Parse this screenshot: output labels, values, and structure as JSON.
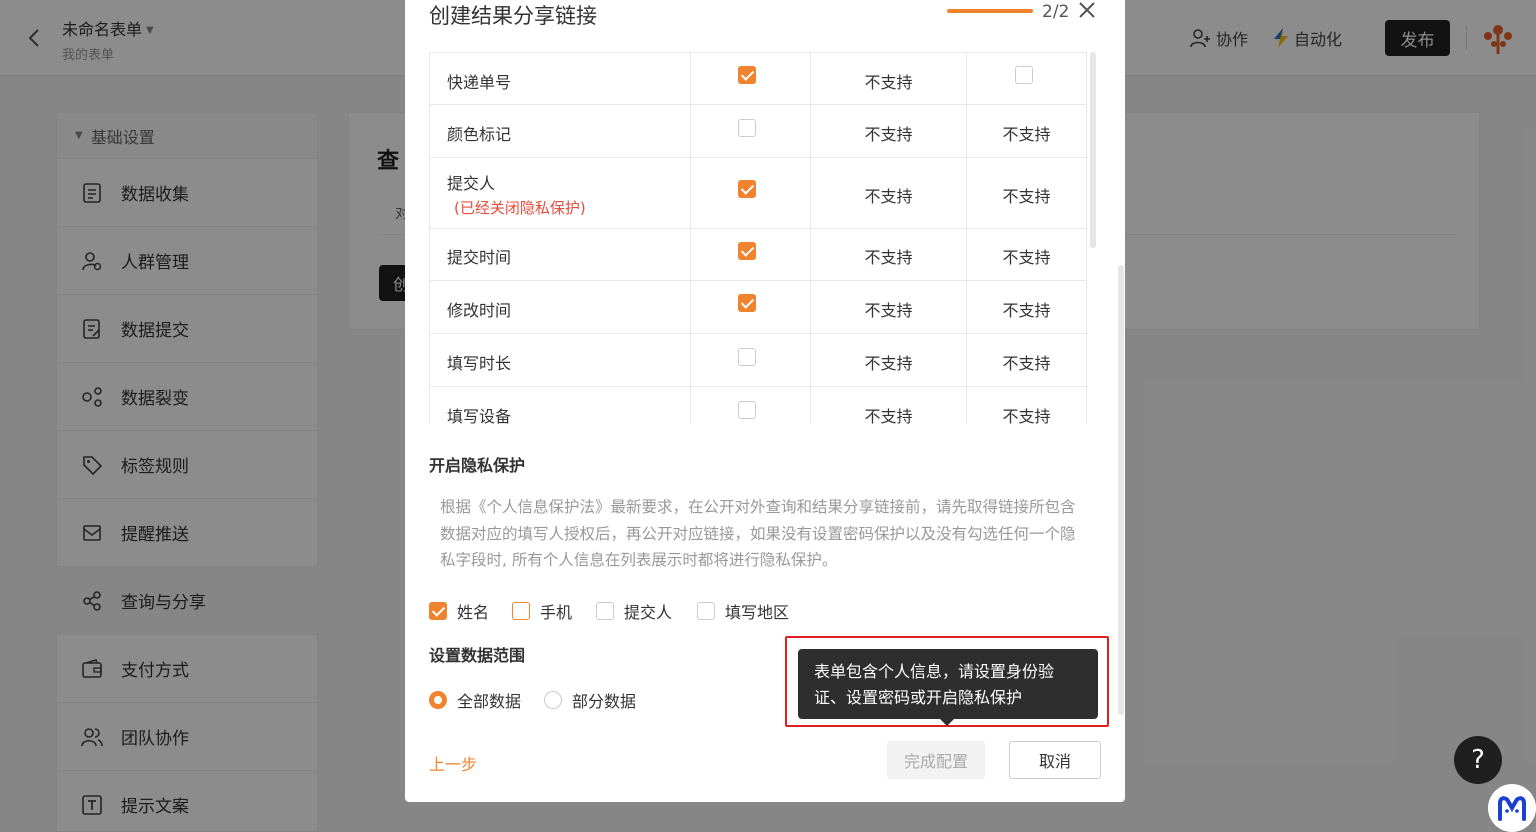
{
  "header": {
    "form_title": "未命名表单",
    "form_subtitle": "我的表单",
    "collab_label": "协作",
    "automation_label": "自动化",
    "publish_label": "发布"
  },
  "sidebar": {
    "section_label": "基础设置",
    "items": [
      {
        "label": "数据收集",
        "icon": "document-icon"
      },
      {
        "label": "人群管理",
        "icon": "person-icon"
      },
      {
        "label": "数据提交",
        "icon": "edit-doc-icon"
      },
      {
        "label": "数据裂变",
        "icon": "fission-icon"
      },
      {
        "label": "标签规则",
        "icon": "tag-icon"
      },
      {
        "label": "提醒推送",
        "icon": "notify-icon"
      },
      {
        "label": "查询与分享",
        "icon": "share-icon"
      },
      {
        "label": "支付方式",
        "icon": "wallet-icon"
      },
      {
        "label": "团队协作",
        "icon": "team-icon"
      },
      {
        "label": "提示文案",
        "icon": "text-icon"
      }
    ]
  },
  "main": {
    "title_partial": "查",
    "sub_partial": "对",
    "button_partial": "创"
  },
  "modal": {
    "title": "创建结果分享链接",
    "step": "2/2",
    "progress_percent": 100,
    "accent_color": "#f0832d",
    "table_rows": [
      {
        "field": "快递单号",
        "note": "",
        "col2": true,
        "col3": "不支持",
        "col4_checkbox": false,
        "col4": ""
      },
      {
        "field": "颜色标记",
        "note": "",
        "col2": false,
        "col3": "不支持",
        "col4_checkbox": null,
        "col4": "不支持"
      },
      {
        "field": "提交人",
        "note": "(已经关闭隐私保护)",
        "col2": true,
        "col3": "不支持",
        "col4_checkbox": null,
        "col4": "不支持"
      },
      {
        "field": "提交时间",
        "note": "",
        "col2": true,
        "col3": "不支持",
        "col4_checkbox": null,
        "col4": "不支持"
      },
      {
        "field": "修改时间",
        "note": "",
        "col2": true,
        "col3": "不支持",
        "col4_checkbox": null,
        "col4": "不支持"
      },
      {
        "field": "填写时长",
        "note": "",
        "col2": false,
        "col3": "不支持",
        "col4_checkbox": null,
        "col4": "不支持"
      },
      {
        "field": "填写设备",
        "note": "",
        "col2": false,
        "col3": "不支持",
        "col4_checkbox": null,
        "col4": "不支持"
      }
    ],
    "privacy": {
      "title": "开启隐私保护",
      "description": "根据《个人信息保护法》最新要求，在公开对外查询和结果分享链接前，请先取得链接所包含数据对应的填写人授权后，再公开对应链接，如果没有设置密码保护以及没有勾选任何一个隐私字段时, 所有个人信息在列表展示时都将进行隐私保护。",
      "options": [
        {
          "label": "姓名",
          "checked": true
        },
        {
          "label": "手机",
          "checked": false
        },
        {
          "label": "提交人",
          "checked": false
        },
        {
          "label": "填写地区",
          "checked": false
        }
      ]
    },
    "range": {
      "title": "设置数据范围",
      "options": [
        {
          "label": "全部数据",
          "selected": true
        },
        {
          "label": "部分数据",
          "selected": false
        }
      ]
    },
    "tooltip": "表单包含个人信息，请设置身份验证、设置密码或开启隐私保护",
    "prev_label": "上一步",
    "finish_label": "完成配置",
    "cancel_label": "取消"
  },
  "help_label": "?"
}
